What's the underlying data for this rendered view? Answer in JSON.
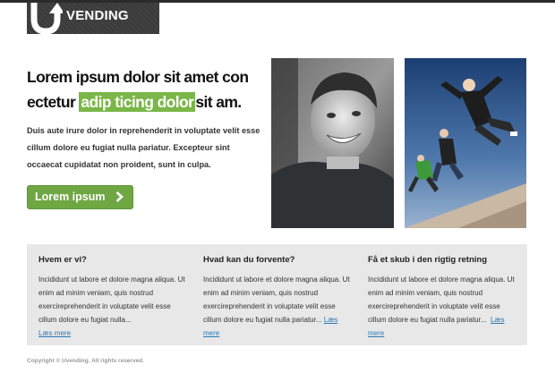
{
  "brand": {
    "name": "VENDING"
  },
  "hero": {
    "headline_part1": "Lorem ipsum dolor sit amet con ectetur",
    "headline_highlight": "adip ticing dolor",
    "headline_part2": "sit am.",
    "intro": "Duis aute irure dolor in reprehenderit in voluptate velit esse cillum dolore eu fugiat nulla pariatur.  Excepteur sint occaecat  cupidatat non proident, sunt in culpa.",
    "cta_label": "Lorem ipsum"
  },
  "features": [
    {
      "title": "Hvem er vi?",
      "text": "Incididunt ut labore et dolore magna aliqua. Ut enim ad minim veniam, quis nostrud exercireprehenderit in voluptate velit esse cillum dolore eu fugiat nulla...",
      "link": "Læs mere"
    },
    {
      "title": "Hvad kan du forvente?",
      "text": "Incididunt ut labore et dolore magna aliqua. Ut enim ad minim veniam, quis nostrud exercireprehenderit in voluptate velit esse cillum dolore eu fugiat nulla pariatur...",
      "link": "Læs mere"
    },
    {
      "title": "Få et skub i den rigtig retning",
      "text": "Incididunt ut labore et dolore magna aliqua. Ut enim ad minim veniam, quis nostrud exercireprehenderit in voluptate velit esse cillum dolore eu fugiat nulla pariatur...",
      "link": "Læs mere"
    }
  ],
  "footer": {
    "copyright": "Copyright © Uvending. All rights reserved."
  },
  "colors": {
    "accent": "#7ab648",
    "button": "#6fa743",
    "panel": "#e8e8e8",
    "header": "#3a3a3a",
    "link": "#2a7ab8"
  },
  "icons": {
    "logo": "u-arrow-logo-icon",
    "cta": "chevron-right-icon"
  }
}
